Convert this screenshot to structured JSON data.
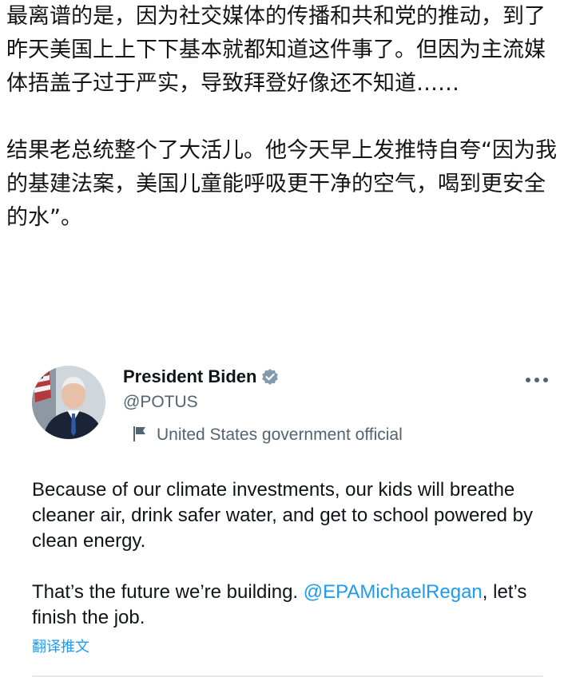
{
  "article": {
    "paragraph_1": "最离谱的是，因为社交媒体的传播和共和党的推动，到了昨天美国上上下下基本就都知道这件事了。但因为主流媒体捂盖子过于严实，导致拜登好像还不知道……",
    "paragraph_2": "结果老总统整个了大活儿。他今天早上发推特自夸“因为我的基建法案，美国儿童能呼吸更干净的空气，喝到更安全的水”。"
  },
  "tweet": {
    "author_name": "President Biden",
    "handle": "@POTUS",
    "label": "United States government official",
    "text_1": "Because of our climate investments, our kids will breathe cleaner air, drink safer water, and get to school powered by clean energy.",
    "text_2_prefix": "That’s the future we’re building. ",
    "mention": "@EPAMichaelRegan",
    "text_2_suffix": ", let’s finish the job.",
    "translate_label": "翻译推文"
  },
  "icons": {
    "verified": "verified-badge-icon",
    "government": "flag-icon",
    "more": "more-options-icon"
  },
  "colors": {
    "link": "#1d9bf0",
    "secondary_text": "#536471",
    "verified_badge": "#829aab"
  }
}
